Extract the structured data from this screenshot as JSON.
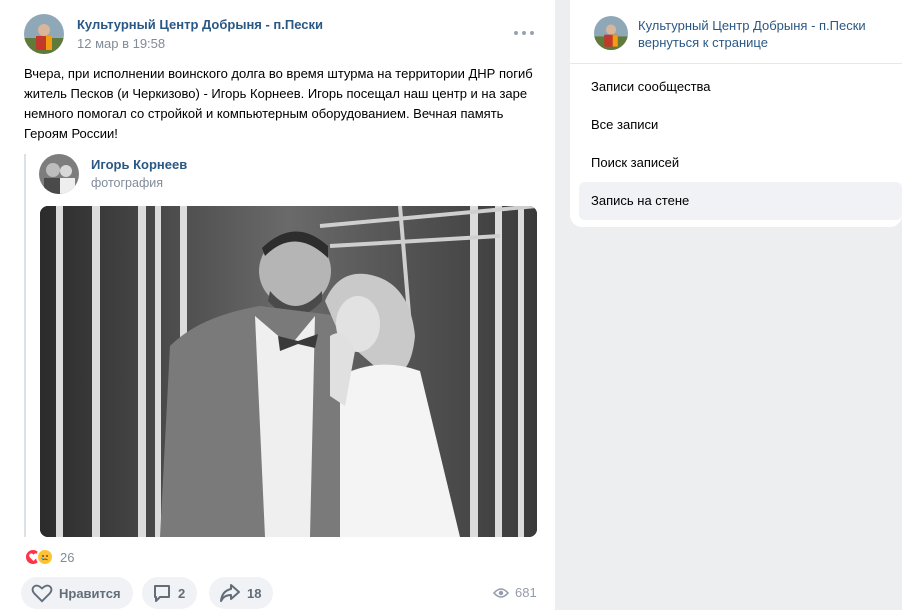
{
  "post": {
    "author": "Культурный Центр Добрыня - п.Пески",
    "date": "12 мар в 19:58",
    "text": "Вчера, при исполнении воинского долга во время штурма на территории ДНР погиб житель Песков (и Черкизово) - Игорь Корнеев. Игорь посещал наш центр и на заре немного помогал со стройкой и компьютерным оборудованием. Вечная память Героям России!",
    "repost": {
      "author": "Игорь Корнеев",
      "subtitle": "фотография"
    },
    "reactions_count": "26",
    "like_label": "Нравится",
    "comments_count": "2",
    "shares_count": "18",
    "views_count": "681",
    "icons": [
      "more-dots-icon",
      "heart-reaction-icon",
      "sad-reaction-icon",
      "like-heart-icon",
      "comment-icon",
      "share-arrow-icon",
      "eye-icon"
    ]
  },
  "sidebar": {
    "community_name": "Культурный Центр Добрыня - п.Пески",
    "back_link": "вернуться к странице",
    "menu": [
      {
        "label": "Записи сообщества",
        "active": false
      },
      {
        "label": "Все записи",
        "active": false
      },
      {
        "label": "Поиск записей",
        "active": false
      },
      {
        "label": "Запись на стене",
        "active": true
      }
    ]
  },
  "colors": {
    "link": "#2a5885",
    "muted": "#818c99",
    "page_bg": "#edeef0",
    "button_bg": "#f0f2f5",
    "heart": "#ff3347"
  }
}
